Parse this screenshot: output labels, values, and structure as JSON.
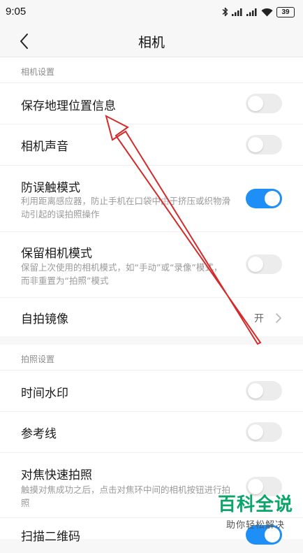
{
  "status_bar": {
    "time": "9:05",
    "battery": "39"
  },
  "header": {
    "title": "相机"
  },
  "camera_settings": {
    "section_title": "相机设置",
    "save_location": {
      "label": "保存地理位置信息",
      "enabled": false
    },
    "camera_sound": {
      "label": "相机声音",
      "enabled": false
    },
    "anti_touch": {
      "label": "防误触模式",
      "desc": "利用距离感应器，防止手机在口袋中由于挤压或织物滑动引起的误拍照操作",
      "enabled": true
    },
    "keep_mode": {
      "label": "保留相机模式",
      "desc": "保留上次使用的相机模式，如“手动”或“录像”模式，而非重置为“拍照”模式",
      "enabled": false
    },
    "selfie_mirror": {
      "label": "自拍镜像",
      "value": "开"
    }
  },
  "shooting_settings": {
    "section_title": "拍照设置",
    "time_watermark": {
      "label": "时间水印",
      "enabled": false
    },
    "grid_lines": {
      "label": "参考线",
      "enabled": false
    },
    "focus_shoot": {
      "label": "对焦快速拍照",
      "desc": "触摸对焦成功之后，点击对焦环中间的相机按钮进行拍照",
      "enabled": false
    },
    "scan_qr": {
      "label": "扫描二维码",
      "enabled": true
    }
  },
  "watermark": {
    "brand": "百科全说",
    "tagline": "助你轻松解决"
  },
  "colors": {
    "accent": "#1e8ff7",
    "annotation_arrow": "#d42a2a",
    "watermark_green": "#0aa56a"
  },
  "icons": [
    "chevron-left-icon",
    "bluetooth-icon",
    "signal-icon",
    "wifi-icon",
    "battery-icon",
    "chevron-right-icon"
  ]
}
